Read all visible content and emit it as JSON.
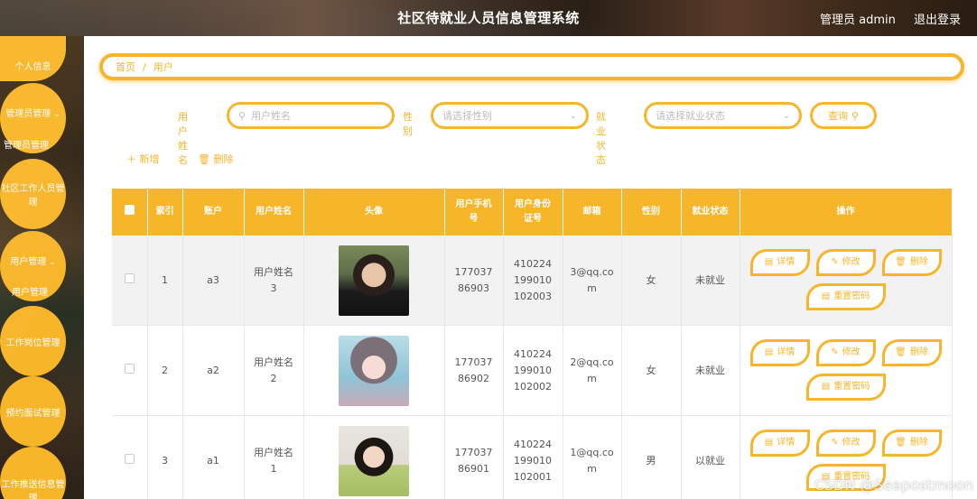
{
  "header": {
    "title": "社区待就业人员信息管理系统",
    "user_label": "管理员 admin",
    "logout_label": "退出登录"
  },
  "sidebar": {
    "items": [
      {
        "label": "个人信息"
      },
      {
        "label": "管理员管理",
        "sub": "管理员管理"
      },
      {
        "label": "社区工作人员管理"
      },
      {
        "label": "用户管理",
        "sub": "用户管理"
      },
      {
        "label": "工作岗位管理"
      },
      {
        "label": "预约面试管理"
      },
      {
        "label": "工作推送信息管理"
      }
    ]
  },
  "breadcrumb": {
    "home": "首页",
    "sep": "/",
    "current": "用户"
  },
  "search": {
    "name_label": "用户姓名",
    "name_placeholder": "用户姓名",
    "gender_label": "性别",
    "gender_placeholder": "请选择性别",
    "status_label": "就业状态",
    "status_placeholder": "请选择就业状态",
    "query_label": "查询"
  },
  "actions": {
    "add_label": "新增",
    "delete_label": "删除"
  },
  "table": {
    "headers": [
      "索引",
      "账户",
      "用户姓名",
      "头像",
      "用户手机号",
      "用户身份证号",
      "邮箱",
      "性别",
      "就业状态",
      "操作"
    ],
    "rows": [
      {
        "index": "1",
        "account": "a3",
        "name": "用户姓名3",
        "phone": "17703786903",
        "idcard": "410224199010102003",
        "email": "3@qq.com",
        "gender": "女",
        "status": "未就业"
      },
      {
        "index": "2",
        "account": "a2",
        "name": "用户姓名2",
        "phone": "17703786902",
        "idcard": "410224199010102002",
        "email": "2@qq.com",
        "gender": "女",
        "status": "未就业"
      },
      {
        "index": "3",
        "account": "a1",
        "name": "用户姓名1",
        "phone": "17703786901",
        "idcard": "410224199010102001",
        "email": "1@qq.com",
        "gender": "男",
        "status": "以就业"
      }
    ],
    "ops": {
      "detail": "详情",
      "edit": "修改",
      "delete": "删除",
      "reset": "重置密码"
    }
  },
  "watermark": "CSDN @Seapostmoon",
  "colors": {
    "accent": "#f7b52a"
  }
}
